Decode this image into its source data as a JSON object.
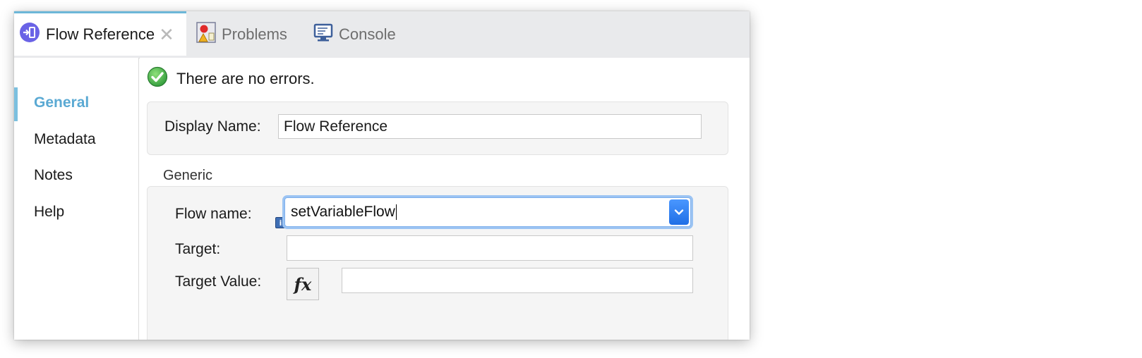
{
  "tabs": [
    {
      "label": "Flow Reference",
      "icon": "flow-reference-icon",
      "active": true,
      "closable": true
    },
    {
      "label": "Problems",
      "icon": "problems-icon",
      "active": false
    },
    {
      "label": "Console",
      "icon": "console-icon",
      "active": false
    }
  ],
  "tab_close_glyph": "✕",
  "sidebar": {
    "items": [
      {
        "label": "General",
        "active": true
      },
      {
        "label": "Metadata",
        "active": false
      },
      {
        "label": "Notes",
        "active": false
      },
      {
        "label": "Help",
        "active": false
      }
    ]
  },
  "status": {
    "text": "There are no errors.",
    "icon": "check-circle-icon",
    "color": "#3fa34d"
  },
  "display_name": {
    "label": "Display Name:",
    "value": "Flow Reference"
  },
  "generic": {
    "title": "Generic",
    "flow_name": {
      "label": "Flow name:",
      "value": "setVariableFlow"
    },
    "target": {
      "label": "Target:",
      "value": ""
    },
    "target_value": {
      "label": "Target Value:",
      "value": "",
      "fx_label": "fx"
    },
    "info_glyph": "i"
  },
  "colors": {
    "accent": "#5aa9d3",
    "combo_focus": "#9cc4f3",
    "combo_button": "#2f80f0"
  }
}
